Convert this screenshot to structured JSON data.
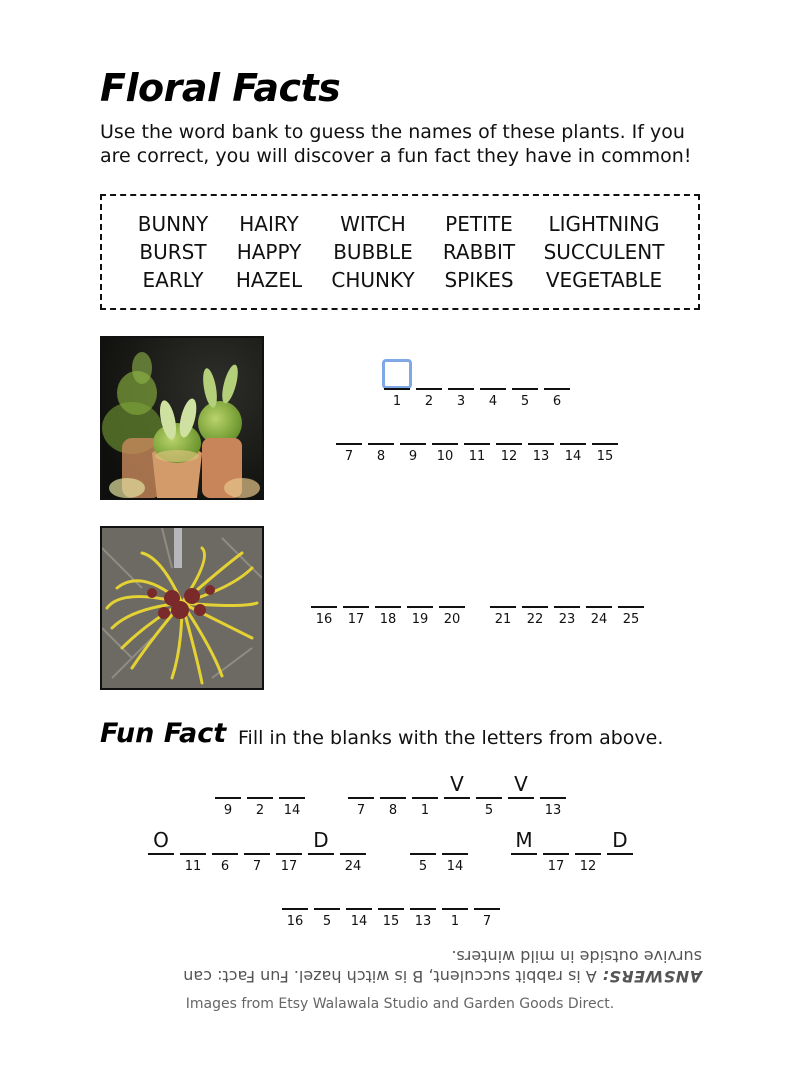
{
  "title": "Floral Facts",
  "intro": "Use the word bank to guess the names of these plants. If you are correct, you will discover a fun fact they have in common!",
  "word_bank": [
    [
      "BUNNY",
      "BURST",
      "EARLY"
    ],
    [
      "HAIRY",
      "HAPPY",
      "HAZEL"
    ],
    [
      "WITCH",
      "BUBBLE",
      "CHUNKY"
    ],
    [
      "PETITE",
      "RABBIT",
      "SPIKES"
    ],
    [
      "LIGHTNING",
      "SUCCULENT",
      "VEGETABLE"
    ]
  ],
  "images": [
    "rabbit-succulent-photo",
    "witch-hazel-photo"
  ],
  "puzzle_a": {
    "row1": [
      "1",
      "2",
      "3",
      "4",
      "5",
      "6"
    ],
    "row2": [
      "7",
      "8",
      "9",
      "10",
      "11",
      "12",
      "13",
      "14",
      "15"
    ]
  },
  "puzzle_b": {
    "word1": [
      "16",
      "17",
      "18",
      "19",
      "20"
    ],
    "word2": [
      "21",
      "22",
      "23",
      "24",
      "25"
    ]
  },
  "fun_fact": {
    "title": "Fun Fact",
    "subtitle": "Fill in the blanks with the letters from above.",
    "row1_w1": [
      {
        "l": "",
        "n": "9"
      },
      {
        "l": "",
        "n": "2"
      },
      {
        "l": "",
        "n": "14"
      }
    ],
    "row1_w2": [
      {
        "l": "",
        "n": "7"
      },
      {
        "l": "",
        "n": "8"
      },
      {
        "l": "",
        "n": "1"
      },
      {
        "l": "V",
        "n": ""
      },
      {
        "l": "",
        "n": "5"
      },
      {
        "l": "V",
        "n": ""
      },
      {
        "l": "",
        "n": "13"
      }
    ],
    "row2_w1": [
      {
        "l": "O",
        "n": ""
      },
      {
        "l": "",
        "n": "11"
      },
      {
        "l": "",
        "n": "6"
      },
      {
        "l": "",
        "n": "7"
      },
      {
        "l": "",
        "n": "17"
      },
      {
        "l": "D",
        "n": ""
      },
      {
        "l": "",
        "n": "24"
      }
    ],
    "row2_w2": [
      {
        "l": "",
        "n": "5"
      },
      {
        "l": "",
        "n": "14"
      }
    ],
    "row2_w3": [
      {
        "l": "M",
        "n": ""
      },
      {
        "l": "",
        "n": "17"
      },
      {
        "l": "",
        "n": "12"
      },
      {
        "l": "D",
        "n": ""
      }
    ],
    "row3_w1": [
      {
        "l": "",
        "n": "16"
      },
      {
        "l": "",
        "n": "5"
      },
      {
        "l": "",
        "n": "14"
      },
      {
        "l": "",
        "n": "15"
      },
      {
        "l": "",
        "n": "13"
      },
      {
        "l": "",
        "n": "1"
      },
      {
        "l": "",
        "n": "7"
      }
    ]
  },
  "answers": {
    "label": "ANSWERS:",
    "text": " A is rabbit succulent, B is witch hazel. Fun Fact: can survive outside in mild winters."
  },
  "credits": "Images from Etsy Walawala Studio and Garden Goods Direct."
}
